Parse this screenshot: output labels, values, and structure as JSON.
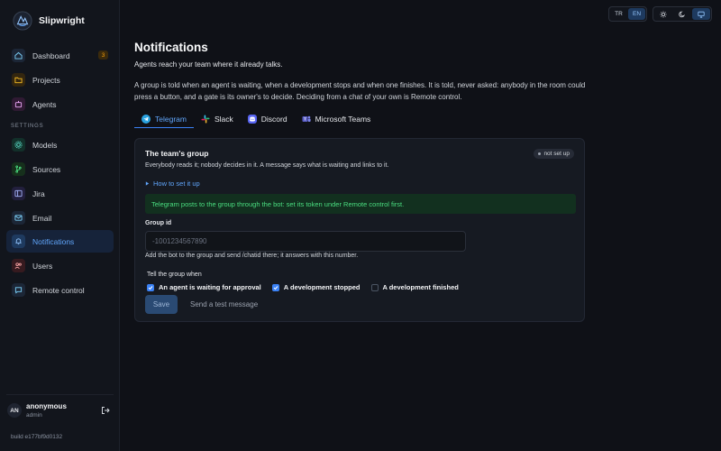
{
  "brand": {
    "name": "Slipwright"
  },
  "sidebar": {
    "items": [
      {
        "label": "Dashboard",
        "badge": "3"
      },
      {
        "label": "Projects"
      },
      {
        "label": "Agents"
      },
      {
        "label": "Models"
      },
      {
        "label": "Sources"
      },
      {
        "label": "Jira"
      },
      {
        "label": "Email"
      },
      {
        "label": "Notifications",
        "active": true
      },
      {
        "label": "Users"
      },
      {
        "label": "Remote control"
      }
    ],
    "section_label": "SETTINGS"
  },
  "user": {
    "initials": "AN",
    "name": "anonymous",
    "role": "admin"
  },
  "build": "build e177bf9d0132",
  "topbar": {
    "languages": [
      "TR",
      "EN"
    ],
    "active_language": "EN",
    "themes": [
      "sun-icon",
      "moon-icon",
      "monitor-icon"
    ],
    "active_theme": "monitor-icon"
  },
  "page": {
    "title": "Notifications",
    "subtitle": "Agents reach your team where it already talks.",
    "description": "A group is told when an agent is waiting, when a development stops and when one finishes. It is told, never asked: anybody in the room could press a button, and a gate is its owner's to decide. Deciding from a chat of your own is Remote control."
  },
  "tabs": [
    {
      "label": "Telegram",
      "active": true
    },
    {
      "label": "Slack"
    },
    {
      "label": "Discord"
    },
    {
      "label": "Microsoft Teams"
    }
  ],
  "card": {
    "title": "The team's group",
    "status": "not set up",
    "description": "Everybody reads it; nobody decides in it. A message says what is waiting and links to it.",
    "howto": "How to set it up",
    "notice": "Telegram posts to the group through the bot: set its token under Remote control first.",
    "group_id_label": "Group id",
    "group_id_placeholder": "-1001234567890",
    "group_id_value": "",
    "group_id_help": "Add the bot to the group and send /chatid there; it answers with this number.",
    "when_label": "Tell the group when",
    "options": [
      {
        "label": "An agent is waiting for approval",
        "checked": true
      },
      {
        "label": "A development stopped",
        "checked": true
      },
      {
        "label": "A development finished",
        "checked": false
      }
    ],
    "save_label": "Save",
    "test_label": "Send a test message"
  },
  "colors": {
    "accent": "#3b82f6",
    "notice_text": "#4ade80",
    "badge": "#f59e0b"
  }
}
